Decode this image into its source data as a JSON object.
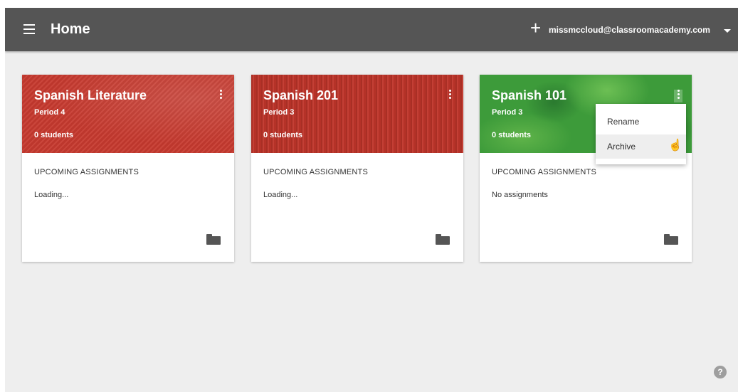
{
  "header": {
    "title": "Home",
    "add_icon": "+",
    "account_email": "missmccloud@classroomacademy.com",
    "menu_icon": "hamburger-menu-icon",
    "caret_icon": "chevron-down-icon"
  },
  "classes": [
    {
      "name": "Spanish Literature",
      "period": "Period 4",
      "students": "0 students",
      "upcoming_label": "UPCOMING ASSIGNMENTS",
      "status": "Loading...",
      "theme_color": "#c73a2f"
    },
    {
      "name": "Spanish 201",
      "period": "Period 3",
      "students": "0 students",
      "upcoming_label": "UPCOMING ASSIGNMENTS",
      "status": "Loading...",
      "theme_color": "#c0352a"
    },
    {
      "name": "Spanish 101",
      "period": "Period 3",
      "students": "0 students",
      "upcoming_label": "UPCOMING ASSIGNMENTS",
      "status": "No assignments",
      "theme_color": "#3d9b3a"
    }
  ],
  "context_menu": {
    "items": [
      "Rename",
      "Archive"
    ],
    "hovered": "Archive"
  },
  "help": {
    "icon": "?"
  }
}
